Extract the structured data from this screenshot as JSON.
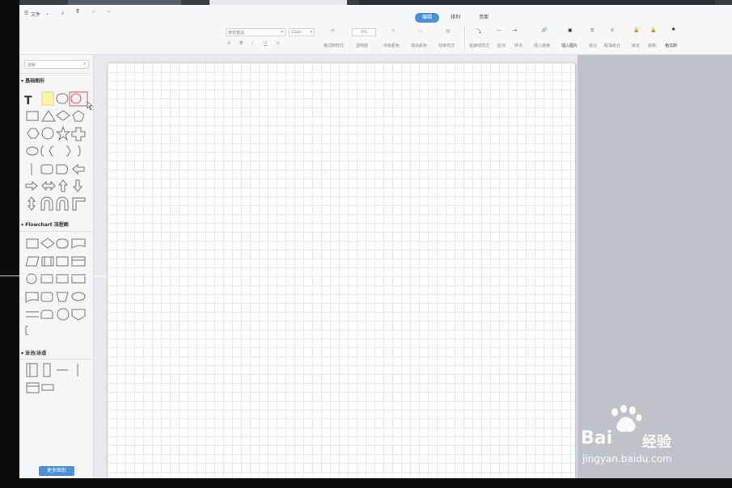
{
  "menubar": {
    "file_menu": "文件",
    "tabs": [
      {
        "label": "编辑",
        "active": true
      },
      {
        "label": "排列",
        "active": false
      },
      {
        "label": "页面",
        "active": false
      }
    ]
  },
  "toolbar": {
    "font_family": "微软雅黑",
    "font_size": "12px",
    "opacity_value": "0%",
    "labels": {
      "format_painter": "格式刷样式",
      "transparency": "透明度",
      "line_color": "线条颜色",
      "fill_color": "填充颜色",
      "shadow": "线条样式",
      "connector_style": "连接线样式",
      "line_style": "起点",
      "line_end": "终点",
      "insert_link": "插入链接",
      "insert_image": "插入图片",
      "group": "组合",
      "ungroup": "取消组合",
      "lock": "锁定",
      "unlock": "解锁",
      "format_brush": "格式刷"
    }
  },
  "sidebar": {
    "search_placeholder": "搜索",
    "sections": [
      {
        "title": "基础图形"
      },
      {
        "title": "Flowchart 流程图"
      },
      {
        "title": "泳池/泳道"
      }
    ],
    "more_shapes_button": "更多图形"
  },
  "watermark": {
    "brand": "Bai",
    "brand2": "经验",
    "url": "jingyan.baidu.com"
  }
}
